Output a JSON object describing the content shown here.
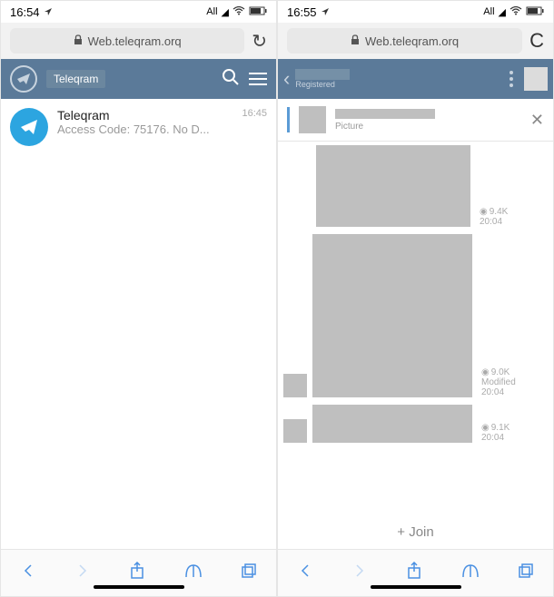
{
  "left": {
    "status": {
      "time": "16:54",
      "net": "All",
      "icons": [
        "location",
        "signal",
        "wifi",
        "battery"
      ]
    },
    "browser": {
      "url": "Web.teleqram.orq",
      "action": "reload"
    },
    "header": {
      "search_label": "Teleqram"
    },
    "chat": {
      "name": "Teleqram",
      "time": "16:45",
      "preview": "Access Code: 75176. No D..."
    }
  },
  "right": {
    "status": {
      "time": "16:55",
      "net": "All",
      "icons": [
        "location",
        "signal",
        "wifi",
        "battery"
      ]
    },
    "browser": {
      "url": "Web.teleqram.orq",
      "action": "C"
    },
    "header": {
      "subtitle": "Registered"
    },
    "pinned": {
      "subtitle": "Picture"
    },
    "messages": [
      {
        "views": "9.4K",
        "time": "20:04",
        "modified": ""
      },
      {
        "views": "9.0K",
        "time": "20:04",
        "modified": "Modified"
      },
      {
        "views": "9.1K",
        "time": "20:04",
        "modified": ""
      }
    ],
    "join": "+ Join"
  }
}
